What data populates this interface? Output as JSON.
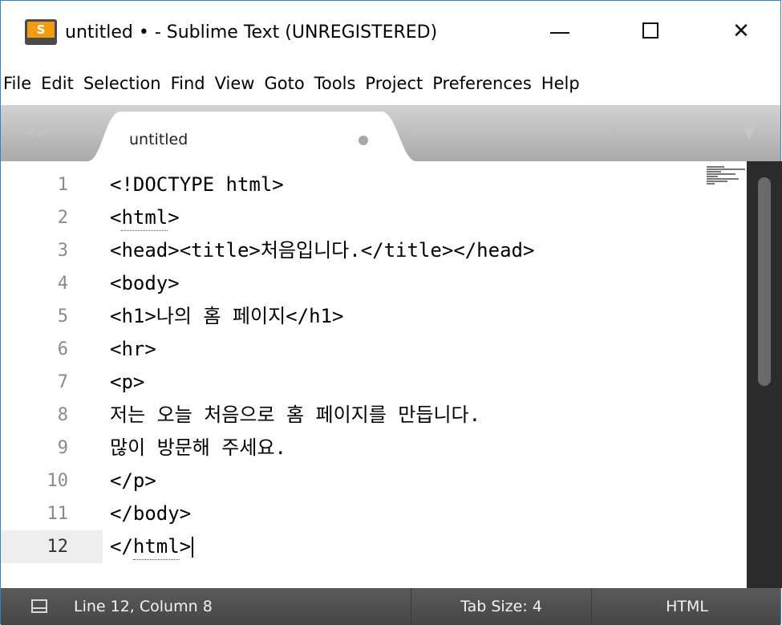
{
  "window": {
    "title": "untitled • - Sublime Text (UNREGISTERED)",
    "app_icon_letter": "S"
  },
  "menu": [
    "File",
    "Edit",
    "Selection",
    "Find",
    "View",
    "Goto",
    "Tools",
    "Project",
    "Preferences",
    "Help"
  ],
  "tab": {
    "label": "untitled",
    "dirty": true
  },
  "editor": {
    "lines": [
      {
        "num": "1",
        "code": "<!DOCTYPE html>"
      },
      {
        "num": "2",
        "code": "<html>"
      },
      {
        "num": "3",
        "code": "<head><title>처음입니다.</title></head>"
      },
      {
        "num": "4",
        "code": "<body>"
      },
      {
        "num": "5",
        "code": "<h1>나의 홈 페이지</h1>"
      },
      {
        "num": "6",
        "code": "<hr>"
      },
      {
        "num": "7",
        "code": "<p>"
      },
      {
        "num": "8",
        "code": "저는 오늘 처음으로 홈 페이지를 만듭니다."
      },
      {
        "num": "9",
        "code": "많이 방문해 주세요."
      },
      {
        "num": "10",
        "code": "</p>"
      },
      {
        "num": "11",
        "code": "</body>"
      },
      {
        "num": "12",
        "code": "</html>"
      }
    ],
    "current_line": "12"
  },
  "status": {
    "position": "Line 12, Column 8",
    "tab_size": "Tab Size: 4",
    "syntax": "HTML"
  },
  "colors": {
    "window_border": "#2b86c9",
    "tab_bar": "#b8b8b8",
    "status_bar": "#4f4f4f",
    "scrollbar": "#2b2b2b"
  }
}
